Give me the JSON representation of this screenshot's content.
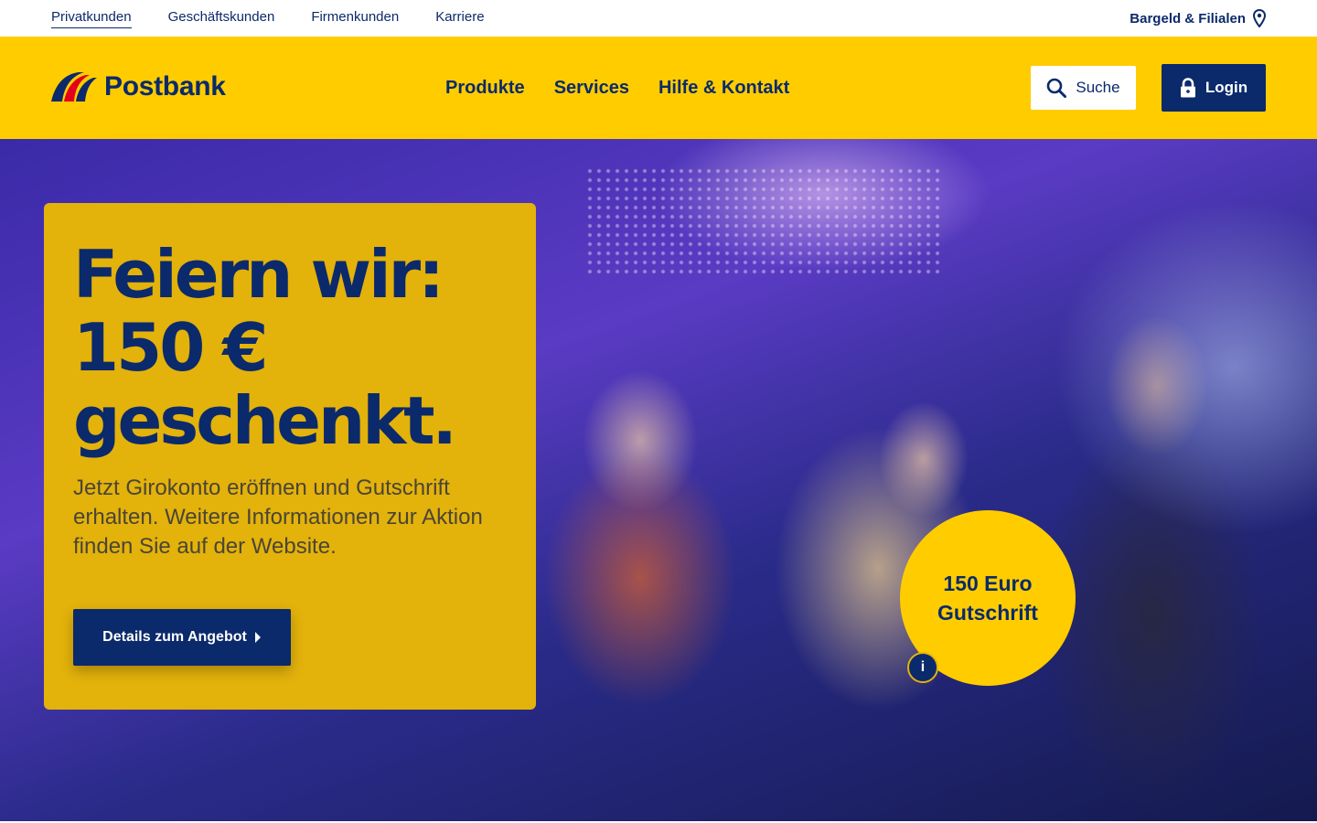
{
  "topbar": {
    "links": [
      {
        "label": "Privatkunden",
        "active": true
      },
      {
        "label": "Geschäftskunden",
        "active": false
      },
      {
        "label": "Firmenkunden",
        "active": false
      },
      {
        "label": "Karriere",
        "active": false
      }
    ],
    "branches_label": "Bargeld & Filialen",
    "branches_icon": "location-pin-icon"
  },
  "header": {
    "logo_text": "Postbank",
    "nav": [
      "Produkte",
      "Services",
      "Hilfe & Kontakt"
    ],
    "search_label": "Suche",
    "login_label": "Login"
  },
  "hero": {
    "title_line1": "Feiern wir:",
    "title_line2": "150 €",
    "title_line3": "geschenkt.",
    "text": "Jetzt Girokonto eröffnen und Gutschrift erhalten. Weitere Informationen zur Aktion finden Sie auf der Website.",
    "cta_label": "Details zum Angebot",
    "badge_line1": "150 Euro",
    "badge_line2": "Gutschrift",
    "info_label": "i"
  },
  "colors": {
    "brand_yellow": "#ffcc00",
    "brand_blue": "#0b2a6b",
    "card_yellow": "#e3b20b",
    "logo_red": "#e2001a"
  }
}
